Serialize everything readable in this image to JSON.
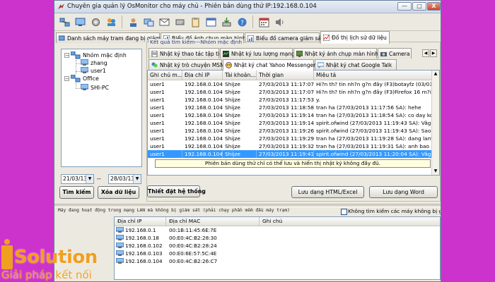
{
  "window": {
    "title": "Chuyên gia quản lý OsMonitor cho máy chủ - Phiên bản dùng thử IP:192.168.0.104",
    "min_glyph": "—",
    "max_glyph": "□",
    "close_glyph": "X"
  },
  "main_tabs": [
    {
      "label": "Danh sách máy tram đang bị giám sát!",
      "icon": "computer-list-icon"
    },
    {
      "label": "Biểu đồ ảnh chụp màn hình",
      "icon": "screenshot-chart-icon"
    },
    {
      "label": "Biểu đồ camera giám sát",
      "icon": "camera-chart-icon"
    },
    {
      "label": "Đồ thị lịch sử dữ liệu",
      "icon": "history-chart-icon"
    }
  ],
  "search_group": {
    "legend": "Kết quả tìm kiếm---Nhóm mặc định"
  },
  "tree": {
    "root1": "Nhóm mặc định",
    "root1_children": [
      "zhang",
      "user1"
    ],
    "root2": "Office",
    "root2_children": [
      "SHI-PC"
    ]
  },
  "dates": {
    "from": "21/03/13",
    "to": "28/03/13",
    "separator": "--"
  },
  "buttons": {
    "search": "Tìm kiếm",
    "clear": "Xóa dữ liệu",
    "settings": "Thiết đặt hệ thống",
    "save_html": "Lưu dạng HTML/Excel",
    "save_word": "Lưu dạng Word"
  },
  "log_tabs_row1": [
    {
      "label": "Nhật ký thao tác tập tin",
      "icon": "file-log-icon"
    },
    {
      "label": "Nhật ký lưu lượng mạng",
      "icon": "network-log-icon"
    },
    {
      "label": "Nhật ký ảnh chụp màn hình",
      "icon": "screenshot-log-icon"
    },
    {
      "label": "Camera",
      "icon": "camera-icon"
    }
  ],
  "log_tabs_row2": [
    {
      "label": "Nhật ký trò chuyện MSN",
      "icon": "msn-icon"
    },
    {
      "label": "Nhật ký chat Yahoo Messenger",
      "icon": "yahoo-icon"
    },
    {
      "label": "Nhật ký chat Google Talk",
      "icon": "gtalk-icon"
    }
  ],
  "log_table": {
    "columns": [
      "Ghi chú m...",
      "Địa chỉ IP",
      "Tài khoản...",
      "Thời gian",
      "Miêu tả"
    ],
    "rows": [
      [
        "user1",
        "192.168.0.104",
        "Shijze",
        "27/03/2013 11:17:07...",
        "Hi?n th? tin nh?n g?n đây (F3)botayfz (03/03/2013"
      ],
      [
        "user1",
        "192.168.0.104",
        "Shijze",
        "27/03/2013 11:17:07...",
        "Hi?n th? tin nh?n g?n đây (F3)Firefox 16 m?i T?i uu"
      ],
      [
        "user1",
        "192.168.0.104",
        "Shijze",
        "27/03/2013 11:17:53...",
        "y."
      ],
      [
        "user1",
        "192.168.0.104",
        "Shijze",
        "27/03/2013 11:18:58...",
        "tran ha (27/03/2013 11:17:56 SA): hehe"
      ],
      [
        "user1",
        "192.168.0.104",
        "Shijze",
        "27/03/2013 11:19:14...",
        "tran ha (27/03/2013 11:18:54 SA): co day ko em"
      ],
      [
        "user1",
        "192.168.0.104",
        "Shijze",
        "27/03/2013 11:19:14...",
        "spirit.ofwind (27/03/2013 11:19:43 SA): Vâg a"
      ],
      [
        "user1",
        "192.168.0.104",
        "Shijze",
        "27/03/2013 11:19:26...",
        "spirit.ofwind (27/03/2013 11:19:43 SA): Sao th? a"
      ],
      [
        "user1",
        "192.168.0.104",
        "Shijze",
        "27/03/2013 11:19:29...",
        "tran ha (27/03/2013 11:19:28 SA): dang lam ji vay"
      ],
      [
        "user1",
        "192.168.0.104",
        "Shijze",
        "27/03/2013 11:19:32...",
        "tran ha (27/03/2013 11:19:31 SA): anh bao hey"
      ],
      [
        "user1",
        "192.168.0.104",
        "Shijze",
        "27/03/2013 11:19:41...",
        "spirit.ofwind (27/03/2013 11:20:04 SA): Vâg"
      ]
    ],
    "notice": "Phiên bản dùng thử chỉ có thể lưu và hiển thị nhật ký không đầy đủ."
  },
  "network": {
    "header": "Máy đang hoạt động trong mạng LAN mà không bị giám sát (phải chạy phần mềm đầu máy trạm)",
    "checkbox_label": "Không tìm kiếm các máy không bị giám sát trong mạng LAN",
    "columns": [
      "Địa chỉ IP",
      "Địa chỉ MAC",
      "Ghi chú"
    ],
    "rows": [
      [
        "192.168.0.1",
        "00:1B:11:45:6E:7E",
        ""
      ],
      [
        "192.168.0.18",
        "00:E0:4C:B2:28:30",
        ""
      ],
      [
        "192.168.0.102",
        "00:E0:4C:B2:28:24",
        ""
      ],
      [
        "192.168.0.103",
        "00:E0:6E:57:5C:4E",
        ""
      ],
      [
        "192.168.0.104",
        "00:E0:4C:B2:26:C7",
        ""
      ]
    ]
  },
  "brand": {
    "logo_letter": "i",
    "name": "Solution",
    "tagline": "Giải pháp kết nối"
  },
  "colors": {
    "background": "#cc33cc",
    "selection": "#3399ff",
    "brand": "#f0a020"
  }
}
